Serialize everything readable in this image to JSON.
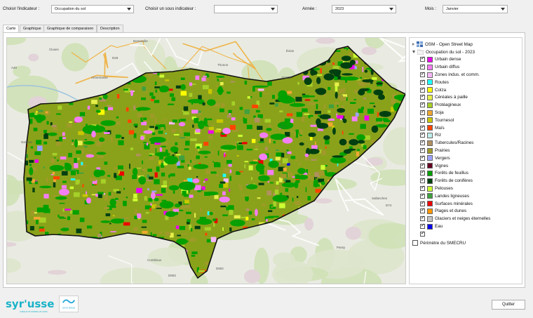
{
  "toolbar": {
    "indicator_label": "Choisir l'indicateur :",
    "indicator_value": "Occupation du sol",
    "subindicator_label": "Choisir un sous indicateur :",
    "subindicator_value": "",
    "year_label": "Année :",
    "year_value": "2023",
    "month_label": "Mois :",
    "month_value": "Janvier"
  },
  "tabs": [
    "Carte",
    "Graphique",
    "Graphique de comparaison",
    "Description"
  ],
  "active_tab": "Carte",
  "legend": {
    "basemap": "OSM - Open Street Map",
    "group": "Occupation du sol - 2023",
    "items": [
      {
        "label": "Urbain dense",
        "color": "#ee00ee"
      },
      {
        "label": "Urbain diffus",
        "color": "#f47ef4"
      },
      {
        "label": "Zones indus. et comm.",
        "color": "#f9b8f9"
      },
      {
        "label": "Routes",
        "color": "#22ffff"
      },
      {
        "label": "Colza",
        "color": "#ffff00"
      },
      {
        "label": "Céréales à paille",
        "color": "#e6f04a"
      },
      {
        "label": "Protéagineux",
        "color": "#a6d028"
      },
      {
        "label": "Soja",
        "color": "#f0a830"
      },
      {
        "label": "Tournesol",
        "color": "#c8c800"
      },
      {
        "label": "Maïs",
        "color": "#ff4400"
      },
      {
        "label": "Riz",
        "color": "#bfeeea"
      },
      {
        "label": "Tubercules/Racines",
        "color": "#b09060"
      },
      {
        "label": "Prairies",
        "color": "#a09a2a"
      },
      {
        "label": "Vergers",
        "color": "#9ea2ff"
      },
      {
        "label": "Vignes",
        "color": "#660022"
      },
      {
        "label": "Forêts de feuillus",
        "color": "#00a000"
      },
      {
        "label": "Forêts de conifères",
        "color": "#004010"
      },
      {
        "label": "Pelouses",
        "color": "#ccff33"
      },
      {
        "label": "Landes ligneuses",
        "color": "#40a040"
      },
      {
        "label": "Surfaces minérales",
        "color": "#ee0000"
      },
      {
        "label": "Plages et dunes",
        "color": "#ff9900"
      },
      {
        "label": "Glaciers et neiges éternelles",
        "color": "#c4c4c4"
      },
      {
        "label": "Eau",
        "color": "#0000ee"
      }
    ],
    "perimeter": "Périmètre du SMECRU"
  },
  "map_labels": [
    "A40",
    "Cluses",
    "Bonneville",
    "Annemasse",
    "Thonon",
    "Évian",
    "Genève",
    "Sallanches",
    "Passy",
    "Combloux",
    "D1205",
    "D902",
    "D26",
    "D903",
    "D74"
  ],
  "logos": {
    "brand": "syr'usses",
    "brand_sub": "SYNDICAT DE RIVIÈRES LES USSES",
    "partner": "arvor group"
  },
  "quit_label": "Quitter"
}
